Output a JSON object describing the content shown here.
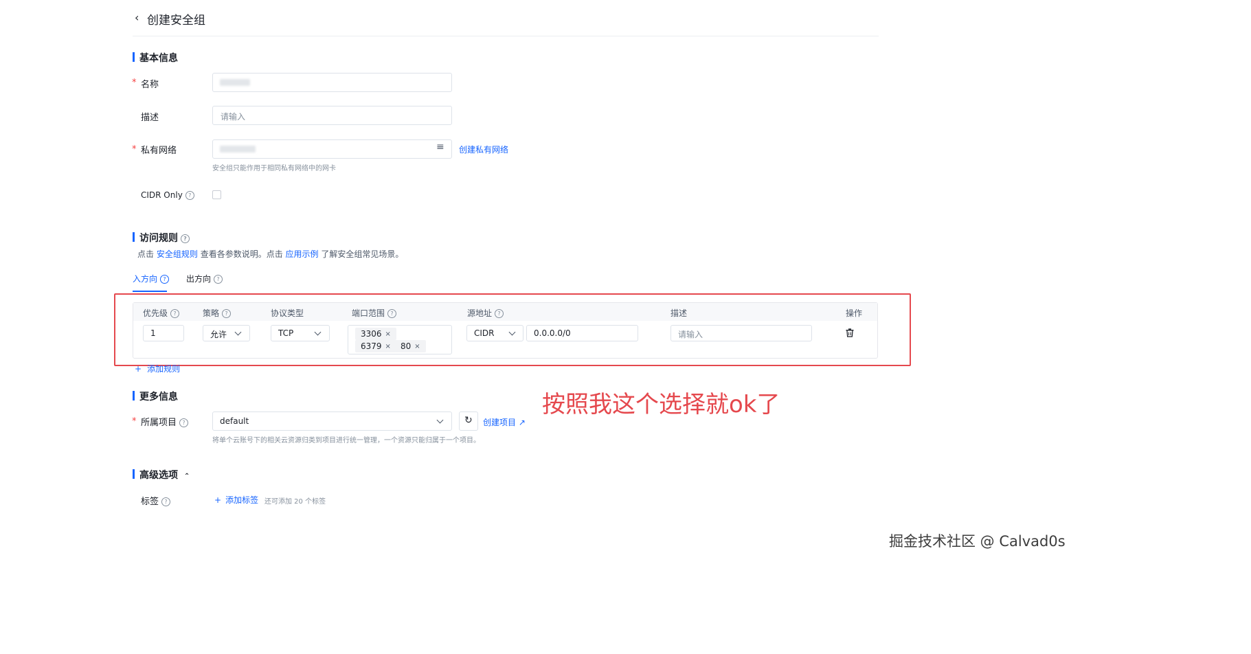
{
  "header": {
    "back_icon": "chevron-left-icon",
    "title": "创建安全组"
  },
  "basic": {
    "section_title": "基本信息",
    "name": {
      "label": "名称",
      "required": "*"
    },
    "description": {
      "label": "描述",
      "placeholder": "请输入"
    },
    "vpc": {
      "label": "私有网络",
      "required": "*",
      "create_link": "创建私有网络",
      "hint": "安全组只能作用于相同私有网络中的网卡"
    },
    "cidr_only": {
      "label": "CIDR Only",
      "help": "?"
    }
  },
  "rules": {
    "section_title": "访问规则",
    "help": "?",
    "desc_prefix": "点击",
    "desc_link1": "安全组规则",
    "desc_middle": "查看各参数说明。点击",
    "desc_link2": "应用示例",
    "desc_suffix": "了解安全组常见场景。",
    "tabs": [
      {
        "label": "入方向",
        "active": true
      },
      {
        "label": "出方向",
        "active": false
      }
    ],
    "columns": {
      "priority": "优先级",
      "policy": "策略",
      "protocol": "协议类型",
      "port_range": "端口范围",
      "source": "源地址",
      "desc": "描述",
      "action": "操作"
    },
    "row": {
      "priority": "1",
      "policy": "允许",
      "protocol": "TCP",
      "ports": [
        "3306",
        "6379",
        "80"
      ],
      "source_type": "CIDR",
      "source_value": "0.0.0.0/0",
      "desc_placeholder": "请输入"
    },
    "add_rule": "添加规则"
  },
  "annotation": "按照我这个选择就ok了",
  "more": {
    "section_title": "更多信息",
    "project": {
      "label": "所属项目",
      "required": "*",
      "value": "default",
      "create_link": "创建项目",
      "hint": "将单个云账号下的相关云资源归类到项目进行统一管理，一个资源只能归属于一个项目。"
    }
  },
  "advanced": {
    "section_title": "高级选项",
    "tags": {
      "label": "标签",
      "add_link": "添加标签",
      "hint": "还可添加 20 个标签"
    }
  },
  "watermark": "掘金技术社区 @ Calvad0s",
  "colors": {
    "accent": "#1664ff",
    "required": "#f53f3f",
    "annotation": "#e5484d"
  }
}
